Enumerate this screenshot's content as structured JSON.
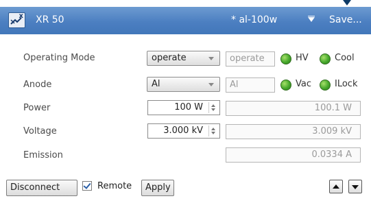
{
  "window": {
    "title": "XR 50",
    "preset": "* al-100w",
    "save_label": "Save..."
  },
  "rows": {
    "operating_mode": {
      "label": "Operating Mode",
      "selected": "operate",
      "readback": "operate"
    },
    "anode": {
      "label": "Anode",
      "selected": "Al",
      "readback": "Al"
    },
    "power": {
      "label": "Power",
      "setpoint": "100 W",
      "readback": "100.1 W"
    },
    "voltage": {
      "label": "Voltage",
      "setpoint": "3.000 kV",
      "readback": "3.009 kV"
    },
    "emission": {
      "label": "Emission",
      "readback": "0.0334 A"
    }
  },
  "indicators": {
    "hv": {
      "label": "HV",
      "color": "#46a82c"
    },
    "cool": {
      "label": "Cool",
      "color": "#46a82c"
    },
    "vac": {
      "label": "Vac",
      "color": "#46a82c"
    },
    "ilock": {
      "label": "ILock",
      "color": "#46a82c"
    }
  },
  "footer": {
    "disconnect_label": "Disconnect",
    "remote_label": "Remote",
    "remote_checked": true,
    "apply_label": "Apply"
  },
  "icons": {
    "app_logo": "xr-source-icon",
    "preset_menu": "filter-triangle-icon",
    "move_up": "arrow-up-icon",
    "move_down": "arrow-down-icon"
  }
}
